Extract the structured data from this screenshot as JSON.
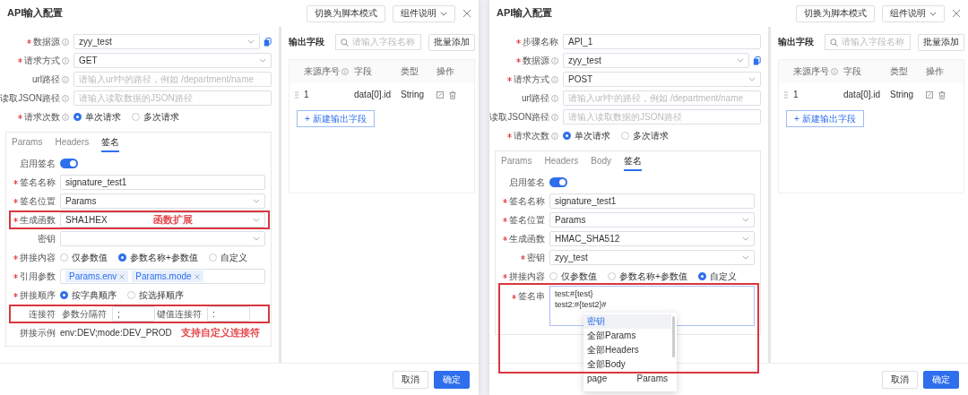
{
  "dialogs": [
    {
      "title": "API输入配置",
      "header_buttons": [
        {
          "label": "切换为脚本模式",
          "kind": "plain"
        },
        {
          "label": "组件说明",
          "kind": "dropdown"
        }
      ],
      "form": [
        {
          "label": "数据源",
          "required": true,
          "info": true,
          "kind": "select",
          "value": "zyy_test",
          "copy": true
        },
        {
          "label": "请求方式",
          "required": true,
          "info": true,
          "kind": "select",
          "value": "GET"
        },
        {
          "label": "url路径",
          "required": false,
          "info": true,
          "kind": "text",
          "placeholder": "请输入url中的路径，例如 /department/name"
        },
        {
          "label": "读取JSON路径",
          "required": false,
          "info": true,
          "kind": "text",
          "placeholder": "请输入读取数据的JSON路径"
        },
        {
          "label": "请求次数",
          "required": true,
          "info": true,
          "kind": "radio",
          "options": [
            {
              "label": "单次请求",
              "selected": true
            },
            {
              "label": "多次请求",
              "selected": false
            }
          ]
        }
      ],
      "tabs": [
        {
          "label": "Params",
          "selected": false
        },
        {
          "label": "Headers",
          "selected": false
        },
        {
          "label": "签名",
          "selected": true
        }
      ],
      "signature": [
        {
          "label": "启用签名",
          "required": false,
          "kind": "toggle",
          "on": true
        },
        {
          "label": "签名名称",
          "required": true,
          "kind": "text",
          "value": "signature_test1"
        },
        {
          "label": "签名位置",
          "required": true,
          "kind": "select",
          "value": "Params"
        },
        {
          "label": "生成函数",
          "required": true,
          "kind": "select",
          "value": "SHA1HEX",
          "highlight": true,
          "note": "函数扩展"
        },
        {
          "label": "密钥",
          "required": false,
          "kind": "select"
        },
        {
          "label": "拼接内容",
          "required": true,
          "kind": "radio",
          "options": [
            {
              "label": "仅参数值",
              "selected": false
            },
            {
              "label": "参数名称+参数值",
              "selected": true
            },
            {
              "label": "自定义",
              "selected": false
            }
          ]
        },
        {
          "label": "引用参数",
          "required": true,
          "kind": "tags",
          "tags": [
            "Params.env",
            "Params.mode"
          ]
        },
        {
          "label": "拼接顺序",
          "required": true,
          "kind": "radio",
          "options": [
            {
              "label": "按字典顺序",
              "selected": true
            },
            {
              "label": "按选择顺序",
              "selected": false
            }
          ]
        },
        {
          "label": "连接符",
          "required": false,
          "kind": "joiners",
          "highlight": true,
          "parts": [
            {
              "label": "参数分隔符",
              "value": ";"
            },
            {
              "label": "键值连接符",
              "value": ":"
            }
          ]
        },
        {
          "label": "拼接示例",
          "required": false,
          "kind": "example",
          "value": "env:DEV;mode:DEV_PROD",
          "note": "支持自定义连接符"
        }
      ],
      "output": {
        "title": "输出字段",
        "search_placeholder": "请输入字段名称",
        "add_button": "批量添加",
        "columns": [
          {
            "label": "来源序号",
            "info": true
          },
          {
            "label": "字段",
            "info": false
          },
          {
            "label": "类型",
            "info": false
          },
          {
            "label": "操作",
            "info": false
          }
        ],
        "rows": [
          {
            "index": "1",
            "field": "data[0].id",
            "type": "String"
          }
        ],
        "new_button": "+ 新建输出字段"
      },
      "footer": [
        {
          "label": "取消",
          "kind": "secondary"
        },
        {
          "label": "确定",
          "kind": "primary"
        }
      ]
    },
    {
      "title": "API输入配置",
      "header_buttons": [
        {
          "label": "切换为脚本模式",
          "kind": "plain"
        },
        {
          "label": "组件说明",
          "kind": "dropdown"
        }
      ],
      "form": [
        {
          "label": "步骤名称",
          "required": true,
          "info": false,
          "kind": "text",
          "value": "API_1"
        },
        {
          "label": "数据源",
          "required": true,
          "info": true,
          "kind": "select",
          "value": "zyy_test",
          "copy": true
        },
        {
          "label": "请求方式",
          "required": true,
          "info": true,
          "kind": "select",
          "value": "POST"
        },
        {
          "label": "url路径",
          "required": false,
          "info": true,
          "kind": "text",
          "placeholder": "请输入url中的路径，例如 /department/name"
        },
        {
          "label": "读取JSON路径",
          "required": false,
          "info": true,
          "kind": "text",
          "placeholder": "请输入读取数据的JSON路径"
        },
        {
          "label": "请求次数",
          "required": true,
          "info": true,
          "kind": "radio",
          "options": [
            {
              "label": "单次请求",
              "selected": true
            },
            {
              "label": "多次请求",
              "selected": false
            }
          ]
        }
      ],
      "tabs": [
        {
          "label": "Params",
          "selected": false
        },
        {
          "label": "Headers",
          "selected": false
        },
        {
          "label": "Body",
          "selected": false
        },
        {
          "label": "签名",
          "selected": true
        }
      ],
      "signature": [
        {
          "label": "启用签名",
          "required": false,
          "kind": "toggle",
          "on": true
        },
        {
          "label": "签名名称",
          "required": true,
          "kind": "text",
          "value": "signature_test1"
        },
        {
          "label": "签名位置",
          "required": true,
          "kind": "select",
          "value": "Params"
        },
        {
          "label": "生成函数",
          "required": true,
          "kind": "select",
          "value": "HMAC_SHA512"
        },
        {
          "label": "密钥",
          "required": true,
          "kind": "select",
          "value": "zyy_test"
        },
        {
          "label": "拼接内容",
          "required": true,
          "kind": "radio",
          "options": [
            {
              "label": "仅参数值",
              "selected": false
            },
            {
              "label": "参数名称+参数值",
              "selected": false
            },
            {
              "label": "自定义",
              "selected": true
            }
          ]
        },
        {
          "label": "签名串",
          "required": true,
          "kind": "textarea",
          "value": "test:#{test}\ntest2:#{test2}#",
          "highlight": true,
          "menu": [
            {
              "label": "密钥",
              "selected": true
            },
            {
              "label": "全部Params",
              "selected": false
            },
            {
              "label": "全部Headers",
              "selected": false
            },
            {
              "label": "全部Body",
              "selected": false
            },
            {
              "label": "page",
              "detail": "Params",
              "selected": false
            }
          ]
        }
      ],
      "output": {
        "title": "输出字段",
        "search_placeholder": "请输入字段名称",
        "add_button": "批量添加",
        "columns": [
          {
            "label": "来源序号",
            "info": true
          },
          {
            "label": "字段",
            "info": false
          },
          {
            "label": "类型",
            "info": false
          },
          {
            "label": "操作",
            "info": false
          }
        ],
        "rows": [
          {
            "index": "1",
            "field": "data[0].id",
            "type": "String"
          }
        ],
        "new_button": "+ 新建输出字段"
      },
      "footer": [
        {
          "label": "取消",
          "kind": "secondary"
        },
        {
          "label": "确定",
          "kind": "primary"
        }
      ]
    }
  ]
}
